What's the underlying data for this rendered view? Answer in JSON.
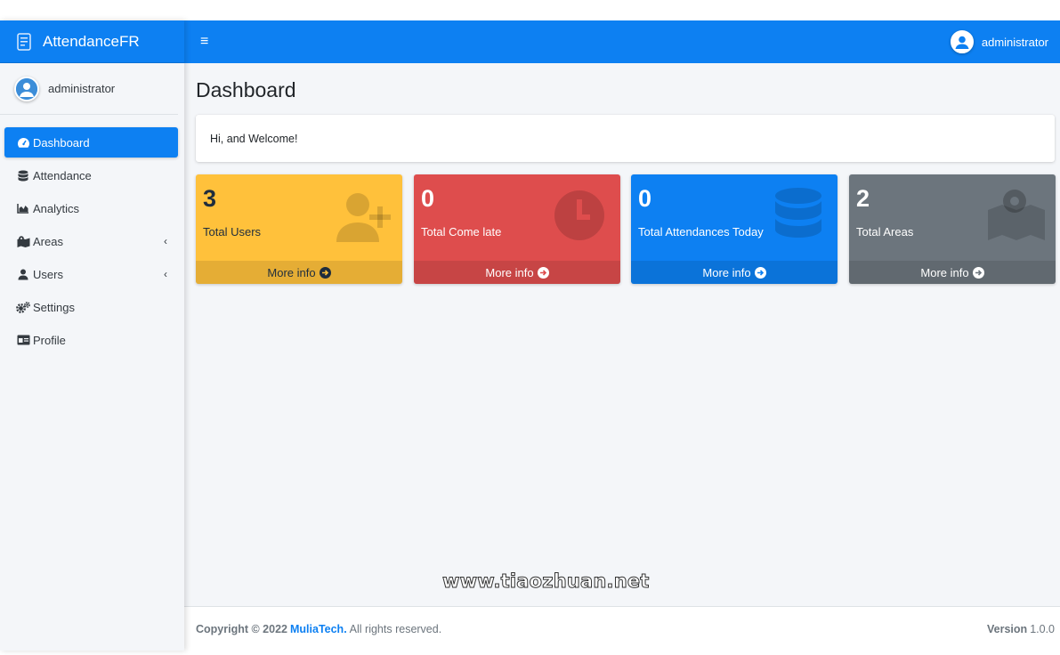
{
  "brand": {
    "name_main": "Attendance",
    "name_suffix": "FR"
  },
  "sidebar": {
    "user_name": "administrator",
    "items": [
      {
        "label": "Dashboard",
        "icon": "gauge-icon",
        "active": true
      },
      {
        "label": "Attendance",
        "icon": "database-icon"
      },
      {
        "label": "Analytics",
        "icon": "area-chart-icon"
      },
      {
        "label": "Areas",
        "icon": "map-icon",
        "caret": "‹"
      },
      {
        "label": "Users",
        "icon": "user-icon",
        "caret": "‹"
      },
      {
        "label": "Settings",
        "icon": "cogs-icon"
      },
      {
        "label": "Profile",
        "icon": "id-card-icon"
      }
    ]
  },
  "header": {
    "menu_glyph": "≡",
    "user_name": "administrator"
  },
  "main": {
    "page_title": "Dashboard",
    "welcome_text": "Hi, and Welcome!",
    "boxes": [
      {
        "value": "3",
        "label": "Total Users",
        "footer": "More info",
        "color": "#ffc13b",
        "icon": "user-plus-icon"
      },
      {
        "value": "0",
        "label": "Total Come late",
        "footer": "More info",
        "color": "#de4d4d",
        "icon": "clock-icon"
      },
      {
        "value": "0",
        "label": "Total Attendances Today",
        "footer": "More info",
        "color": "#0d80f2",
        "icon": "database-icon"
      },
      {
        "value": "2",
        "label": "Total Areas",
        "footer": "More info",
        "color": "#6c757d",
        "icon": "map-marker-icon"
      }
    ]
  },
  "footer": {
    "copyright_prefix": "Copyright © 2022",
    "company": "MuliaTech.",
    "rights": "All rights reserved.",
    "version_label": "Version",
    "version_number": "1.0.0"
  },
  "watermark": "www.tiaozhuan.net",
  "colors": {
    "primary": "#0d80f2",
    "warning": "#ffc13b",
    "danger": "#de4d4d",
    "secondary": "#6c757d"
  }
}
